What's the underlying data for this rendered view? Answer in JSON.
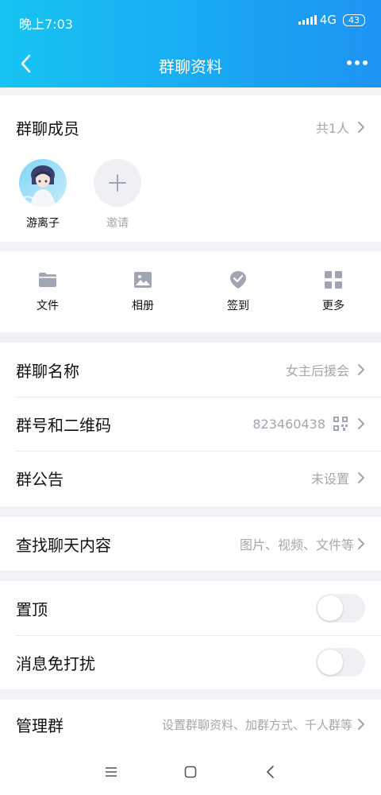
{
  "status_bar": {
    "time": "晚上7:03",
    "network": "4G",
    "battery": "43"
  },
  "nav": {
    "title": "群聊资料"
  },
  "members": {
    "label": "群聊成员",
    "count": "共1人",
    "list": [
      {
        "name": "游离子"
      }
    ],
    "invite_label": "邀请"
  },
  "tools": [
    {
      "label": "文件",
      "icon": "folder-icon"
    },
    {
      "label": "相册",
      "icon": "image-icon"
    },
    {
      "label": "签到",
      "icon": "checkin-icon"
    },
    {
      "label": "更多",
      "icon": "grid-icon"
    }
  ],
  "info": {
    "group_name_label": "群聊名称",
    "group_name_value": "女主后援会",
    "group_id_label": "群号和二维码",
    "group_id_value": "823460438",
    "notice_label": "群公告",
    "notice_value": "未设置"
  },
  "search": {
    "label": "查找聊天内容",
    "value": "图片、视频、文件等"
  },
  "settings": {
    "pin_label": "置顶",
    "pin_on": false,
    "mute_label": "消息免打扰",
    "mute_on": false
  },
  "manage": {
    "label": "管理群",
    "value": "设置群聊资料、加群方式、千人群等"
  },
  "colors": {
    "header_start": "#17c4f2",
    "header_end": "#1e93f2",
    "icon_gray": "#a0a6b3",
    "secondary_text": "#a5a7ae"
  }
}
